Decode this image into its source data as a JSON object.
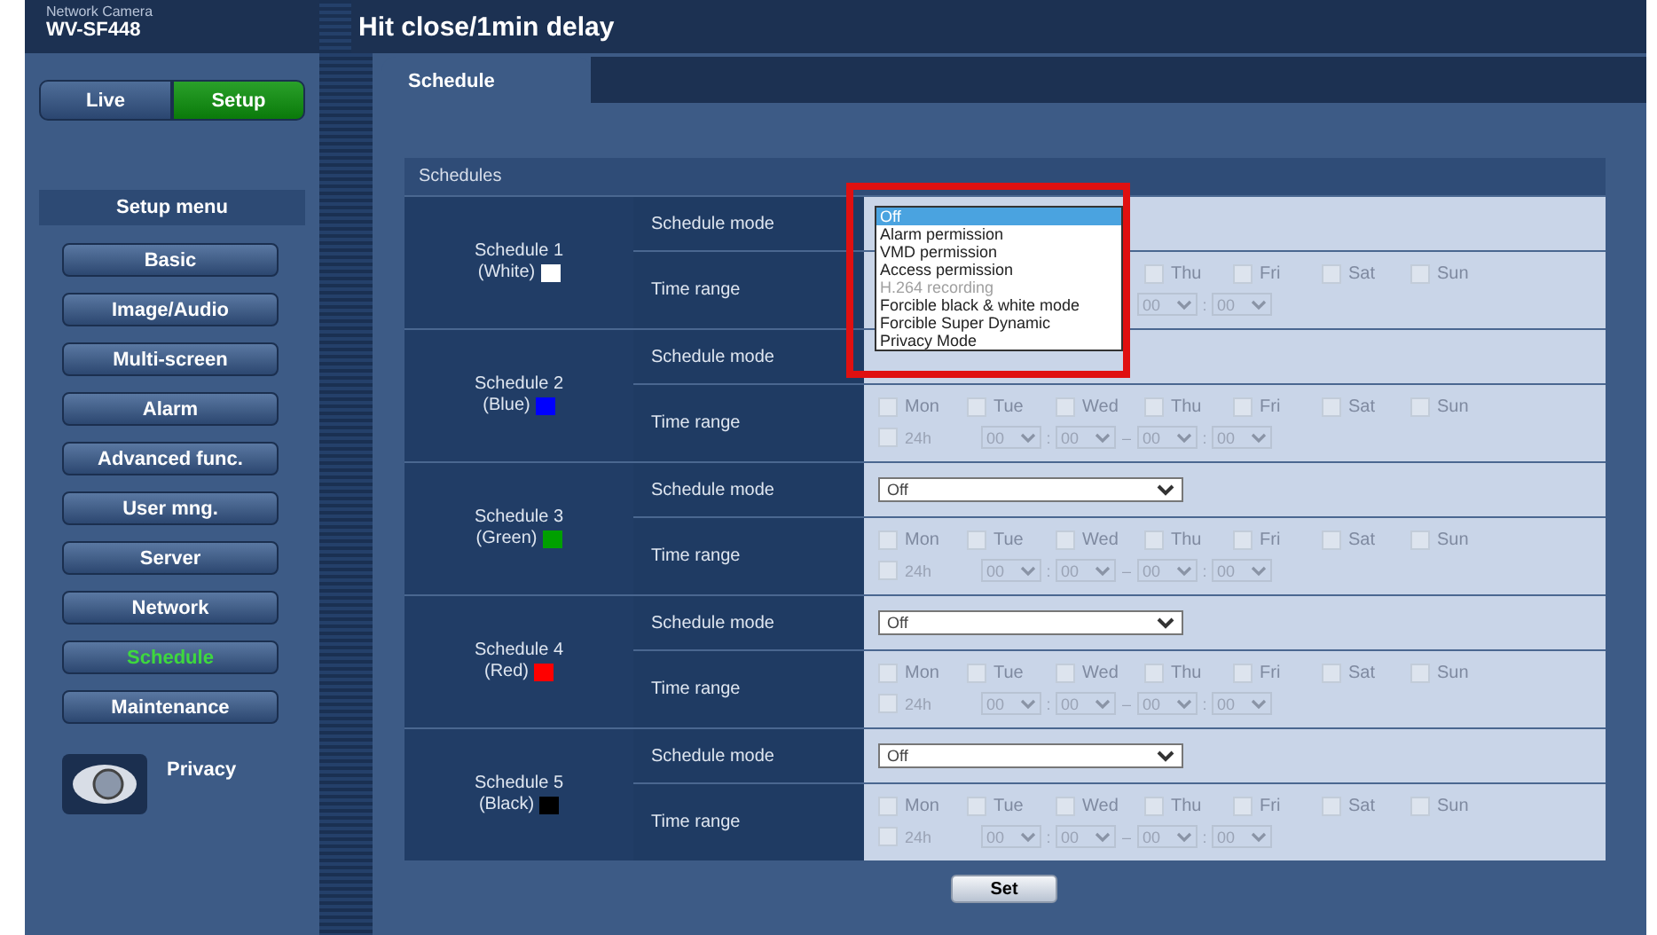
{
  "header": {
    "brand": "Network Camera",
    "model": "WV-SF448",
    "title": "Hit close/1min delay"
  },
  "mode_buttons": [
    {
      "label": "Live",
      "selected": false
    },
    {
      "label": "Setup",
      "selected": true
    }
  ],
  "setup_menu": {
    "title": "Setup menu",
    "items": [
      {
        "label": "Basic",
        "selected": false
      },
      {
        "label": "Image/Audio",
        "selected": false
      },
      {
        "label": "Multi-screen",
        "selected": false
      },
      {
        "label": "Alarm",
        "selected": false
      },
      {
        "label": "Advanced func.",
        "selected": false
      },
      {
        "label": "User mng.",
        "selected": false
      },
      {
        "label": "Server",
        "selected": false
      },
      {
        "label": "Network",
        "selected": false
      },
      {
        "label": "Schedule",
        "selected": true
      },
      {
        "label": "Maintenance",
        "selected": false
      }
    ]
  },
  "privacy": {
    "label": "Privacy"
  },
  "tabs": [
    {
      "label": "Schedule",
      "selected": true
    }
  ],
  "schedules_title": "Schedules",
  "schedules": [
    {
      "name": "Schedule 1",
      "color_name": "(White)",
      "color": "#ffffff",
      "mode_label": "Schedule mode",
      "time_label": "Time range",
      "mode": {
        "kind": "open",
        "options": [
          {
            "label": "Off",
            "selected": true,
            "disabled": false
          },
          {
            "label": "Alarm permission",
            "selected": false,
            "disabled": false
          },
          {
            "label": "VMD permission",
            "selected": false,
            "disabled": false
          },
          {
            "label": "Access permission",
            "selected": false,
            "disabled": false
          },
          {
            "label": "H.264 recording",
            "selected": false,
            "disabled": true
          },
          {
            "label": "Forcible black & white mode",
            "selected": false,
            "disabled": false
          },
          {
            "label": "Forcible Super Dynamic",
            "selected": false,
            "disabled": false
          },
          {
            "label": "Privacy Mode",
            "selected": false,
            "disabled": false
          }
        ]
      },
      "days": [
        {
          "label": "Thu",
          "checked": false
        },
        {
          "label": "Fri",
          "checked": false
        },
        {
          "label": "Sat",
          "checked": false
        },
        {
          "label": "Sun",
          "checked": false
        }
      ],
      "times": [
        {
          "kind": "select",
          "value": "00"
        },
        {
          "kind": "sep",
          "text": ":"
        },
        {
          "kind": "select",
          "value": "00"
        }
      ]
    },
    {
      "name": "Schedule 2",
      "color_name": "(Blue)",
      "color": "#0000ff",
      "mode_label": "Schedule mode",
      "time_label": "Time range",
      "days": [
        {
          "label": "Mon",
          "checked": false
        },
        {
          "label": "Tue",
          "checked": false
        },
        {
          "label": "Wed",
          "checked": false
        },
        {
          "label": "Thu",
          "checked": false
        },
        {
          "label": "Fri",
          "checked": false
        },
        {
          "label": "Sat",
          "checked": false
        },
        {
          "label": "Sun",
          "checked": false
        }
      ],
      "times": [
        {
          "kind": "check",
          "text": "24h",
          "checked": false
        },
        {
          "kind": "select",
          "value": "00"
        },
        {
          "kind": "sep",
          "text": ":"
        },
        {
          "kind": "select",
          "value": "00"
        },
        {
          "kind": "sep",
          "text": "–"
        },
        {
          "kind": "select",
          "value": "00"
        },
        {
          "kind": "sep",
          "text": ":"
        },
        {
          "kind": "select",
          "value": "00"
        }
      ]
    },
    {
      "name": "Schedule 3",
      "color_name": "(Green)",
      "color": "#00a000",
      "mode_label": "Schedule mode",
      "time_label": "Time range",
      "mode": {
        "kind": "closed",
        "value": "Off"
      },
      "days": [
        {
          "label": "Mon",
          "checked": false
        },
        {
          "label": "Tue",
          "checked": false
        },
        {
          "label": "Wed",
          "checked": false
        },
        {
          "label": "Thu",
          "checked": false
        },
        {
          "label": "Fri",
          "checked": false
        },
        {
          "label": "Sat",
          "checked": false
        },
        {
          "label": "Sun",
          "checked": false
        }
      ],
      "times": [
        {
          "kind": "check",
          "text": "24h",
          "checked": false
        },
        {
          "kind": "select",
          "value": "00"
        },
        {
          "kind": "sep",
          "text": ":"
        },
        {
          "kind": "select",
          "value": "00"
        },
        {
          "kind": "sep",
          "text": "–"
        },
        {
          "kind": "select",
          "value": "00"
        },
        {
          "kind": "sep",
          "text": ":"
        },
        {
          "kind": "select",
          "value": "00"
        }
      ]
    },
    {
      "name": "Schedule 4",
      "color_name": "(Red)",
      "color": "#ff0000",
      "mode_label": "Schedule mode",
      "time_label": "Time range",
      "mode": {
        "kind": "closed",
        "value": "Off"
      },
      "days": [
        {
          "label": "Mon",
          "checked": false
        },
        {
          "label": "Tue",
          "checked": false
        },
        {
          "label": "Wed",
          "checked": false
        },
        {
          "label": "Thu",
          "checked": false
        },
        {
          "label": "Fri",
          "checked": false
        },
        {
          "label": "Sat",
          "checked": false
        },
        {
          "label": "Sun",
          "checked": false
        }
      ],
      "times": [
        {
          "kind": "check",
          "text": "24h",
          "checked": false
        },
        {
          "kind": "select",
          "value": "00"
        },
        {
          "kind": "sep",
          "text": ":"
        },
        {
          "kind": "select",
          "value": "00"
        },
        {
          "kind": "sep",
          "text": "–"
        },
        {
          "kind": "select",
          "value": "00"
        },
        {
          "kind": "sep",
          "text": ":"
        },
        {
          "kind": "select",
          "value": "00"
        }
      ]
    },
    {
      "name": "Schedule 5",
      "color_name": "(Black)",
      "color": "#000000",
      "mode_label": "Schedule mode",
      "time_label": "Time range",
      "mode": {
        "kind": "closed",
        "value": "Off"
      },
      "days": [
        {
          "label": "Mon",
          "checked": false
        },
        {
          "label": "Tue",
          "checked": false
        },
        {
          "label": "Wed",
          "checked": false
        },
        {
          "label": "Thu",
          "checked": false
        },
        {
          "label": "Fri",
          "checked": false
        },
        {
          "label": "Sat",
          "checked": false
        },
        {
          "label": "Sun",
          "checked": false
        }
      ],
      "times": [
        {
          "kind": "check",
          "text": "24h",
          "checked": false
        },
        {
          "kind": "select",
          "value": "00"
        },
        {
          "kind": "sep",
          "text": ":"
        },
        {
          "kind": "select",
          "value": "00"
        },
        {
          "kind": "sep",
          "text": "–"
        },
        {
          "kind": "select",
          "value": "00"
        },
        {
          "kind": "sep",
          "text": ":"
        },
        {
          "kind": "select",
          "value": "00"
        }
      ]
    }
  ],
  "set_button": "Set"
}
